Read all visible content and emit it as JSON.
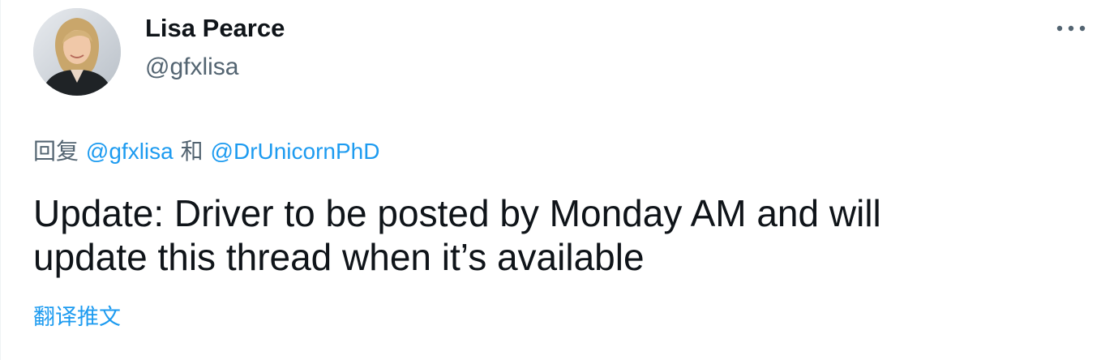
{
  "author": {
    "display_name": "Lisa Pearce",
    "handle": "@gfxlisa",
    "avatar_icon": "profile-photo"
  },
  "menu": {
    "more_icon": "more-horizontal-icon"
  },
  "reply": {
    "prefix": "回复",
    "mentions": [
      "@gfxlisa",
      "@DrUnicornPhD"
    ],
    "separator": "和"
  },
  "tweet": {
    "text": "Update: Driver to be posted by Monday AM and will\nupdate this thread when it’s available"
  },
  "translate": {
    "label": "翻译推文"
  },
  "colors": {
    "link": "#1d9bf0",
    "secondary_text": "#536471",
    "primary_text": "#0f1419"
  }
}
